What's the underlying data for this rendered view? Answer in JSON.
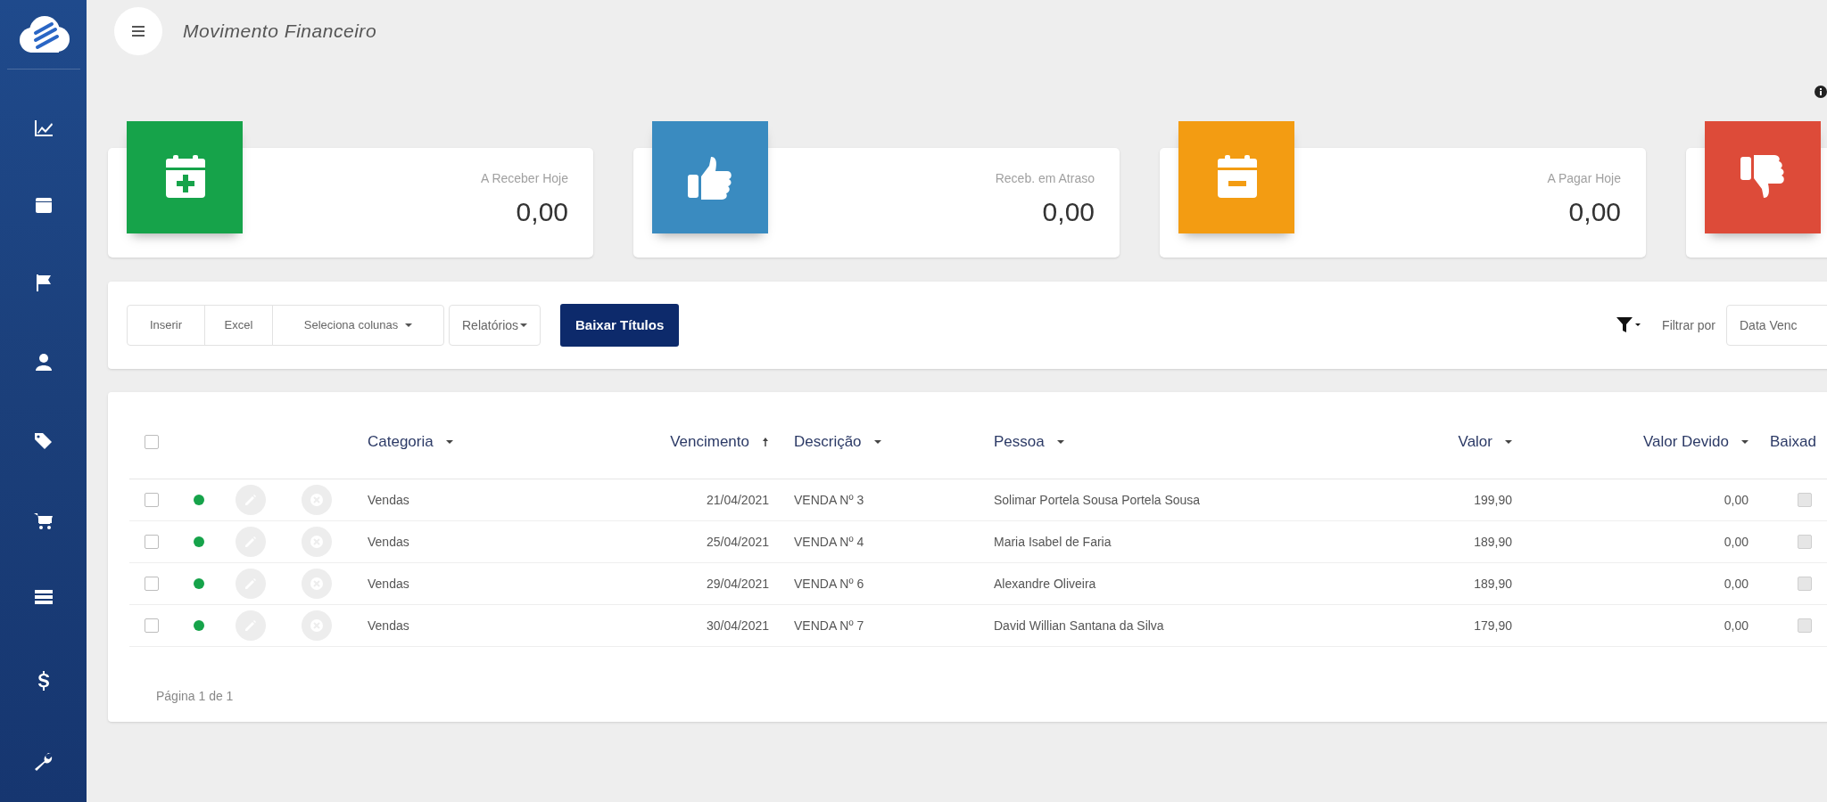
{
  "header": {
    "title": "Movimento Financeiro"
  },
  "cards": [
    {
      "label": "A Receber Hoje",
      "value": "0,00",
      "color": "#16a34a"
    },
    {
      "label": "Receb. em Atraso",
      "value": "0,00",
      "color": "#3a8bc0"
    },
    {
      "label": "A Pagar Hoje",
      "value": "0,00",
      "color": "#f39c12"
    },
    {
      "color": "#dd4b39"
    }
  ],
  "toolbar": {
    "buttons": [
      {
        "label": "Inserir",
        "dropdown": false
      },
      {
        "label": "Excel",
        "dropdown": false
      },
      {
        "label": "Seleciona colunas",
        "dropdown": true
      }
    ],
    "reports": {
      "label": "Relatórios",
      "dropdown": true
    },
    "primary": {
      "label": "Baixar Títulos"
    },
    "filter": {
      "label": "Filtrar por",
      "value": "Data Venc"
    }
  },
  "table": {
    "select_all_checked": false,
    "columns": [
      {
        "label": "Categoria",
        "sorted": false
      },
      {
        "label": "Vencimento",
        "sorted": true
      },
      {
        "label": "Descrição",
        "sorted": false
      },
      {
        "label": "Pessoa",
        "sorted": false
      },
      {
        "label": "Valor",
        "sorted": false
      },
      {
        "label": "Valor Devido",
        "sorted": false
      },
      {
        "label": "Baixad"
      }
    ],
    "rows": [
      {
        "checked": false,
        "color": "#16a34a",
        "categoria": "Vendas",
        "vencimento": "21/04/2021",
        "descricao": "VENDA Nº 3",
        "pessoa": "Solimar Portela Sousa Portela Sousa",
        "valor": "199,90",
        "valor_devido": "0,00",
        "baixado": false
      },
      {
        "checked": false,
        "color": "#16a34a",
        "categoria": "Vendas",
        "vencimento": "25/04/2021",
        "descricao": "VENDA Nº 4",
        "pessoa": "Maria Isabel de Faria",
        "valor": "189,90",
        "valor_devido": "0,00",
        "baixado": false
      },
      {
        "checked": false,
        "color": "#16a34a",
        "categoria": "Vendas",
        "vencimento": "29/04/2021",
        "descricao": "VENDA Nº 6",
        "pessoa": "Alexandre Oliveira",
        "valor": "189,90",
        "valor_devido": "0,00",
        "baixado": false
      },
      {
        "checked": false,
        "color": "#16a34a",
        "categoria": "Vendas",
        "vencimento": "30/04/2021",
        "descricao": "VENDA Nº 7",
        "pessoa": "David Willian Santana da Silva",
        "valor": "179,90",
        "valor_devido": "0,00",
        "baixado": false
      }
    ],
    "pagination": "Página 1 de 1"
  }
}
